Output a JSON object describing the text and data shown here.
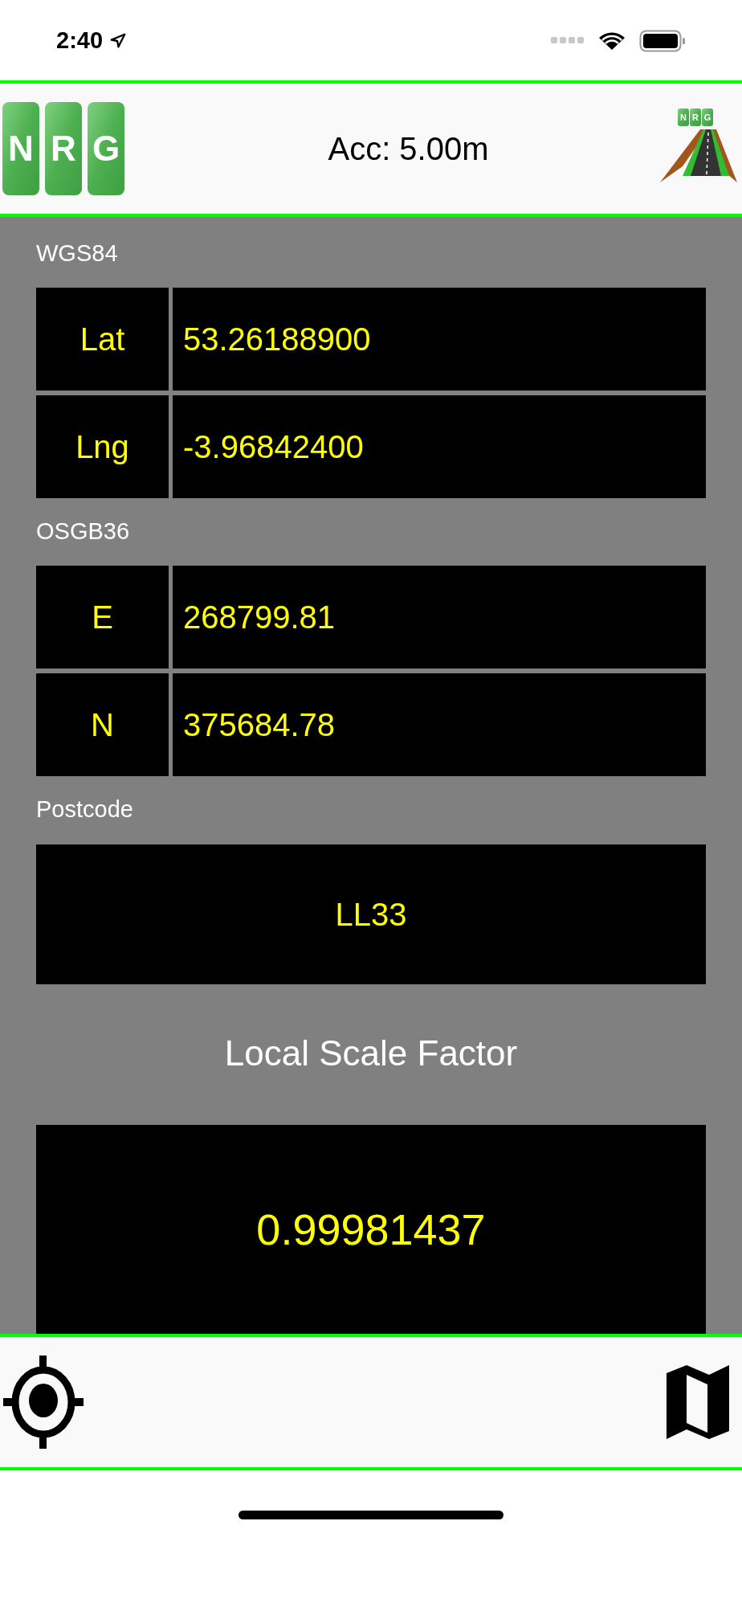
{
  "status_bar": {
    "time": "2:40"
  },
  "header": {
    "logo_letters": [
      "N",
      "R",
      "G"
    ],
    "title": "Acc: 5.00m",
    "app_icon_letters": [
      "N",
      "R",
      "G"
    ]
  },
  "sections": [
    {
      "label": "WGS84",
      "rows": [
        {
          "name": "Lat",
          "value": "53.26188900"
        },
        {
          "name": "Lng",
          "value": "-3.96842400"
        }
      ]
    },
    {
      "label": "OSGB36",
      "rows": [
        {
          "name": "E",
          "value": "268799.81"
        },
        {
          "name": "N",
          "value": "375684.78"
        }
      ]
    }
  ],
  "postcode": {
    "label": "Postcode",
    "value": "LL33"
  },
  "scale_factor": {
    "label": "Local Scale Factor",
    "value": "0.99981437"
  }
}
